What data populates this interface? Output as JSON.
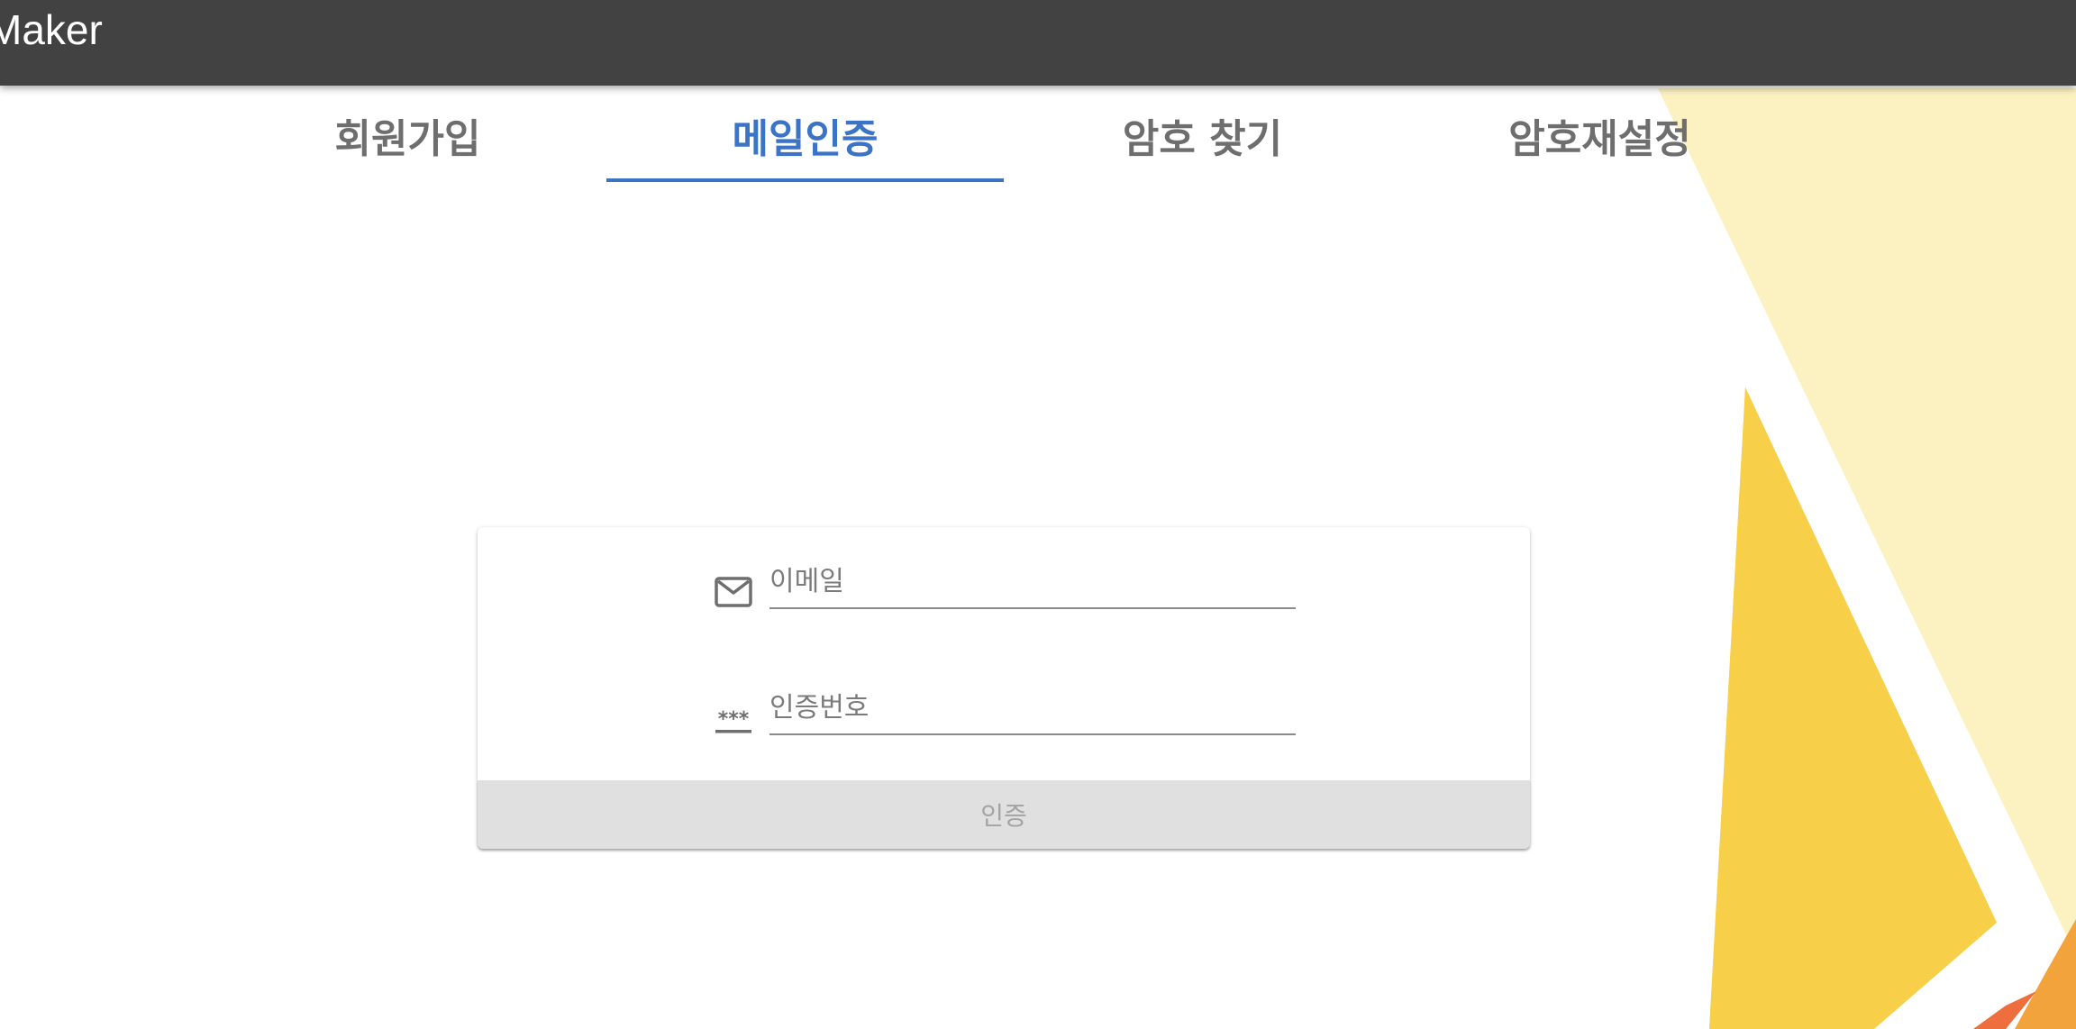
{
  "app": {
    "title": "Maker"
  },
  "tabs": [
    {
      "label": "회원가입",
      "active": false
    },
    {
      "label": "메일인증",
      "active": true
    },
    {
      "label": "암호 찾기",
      "active": false
    },
    {
      "label": "암호재설정",
      "active": false
    }
  ],
  "form": {
    "email": {
      "icon": "mail-icon",
      "placeholder": "이메일",
      "value": ""
    },
    "code": {
      "icon": "password-dots-icon",
      "placeholder": "인증번호",
      "value": ""
    },
    "submit_label": "인증",
    "submit_enabled": false
  },
  "colors": {
    "app_bar": "#424242",
    "accent": "#3b74c6",
    "tab_inactive": "#6e6e6e",
    "button_disabled_bg": "#e0e0e0",
    "decor_pale_yellow": "#fbf1c1",
    "decor_yellow": "#f7cf48",
    "decor_orange": "#f3a33b",
    "decor_red_orange": "#ef6e3d"
  }
}
